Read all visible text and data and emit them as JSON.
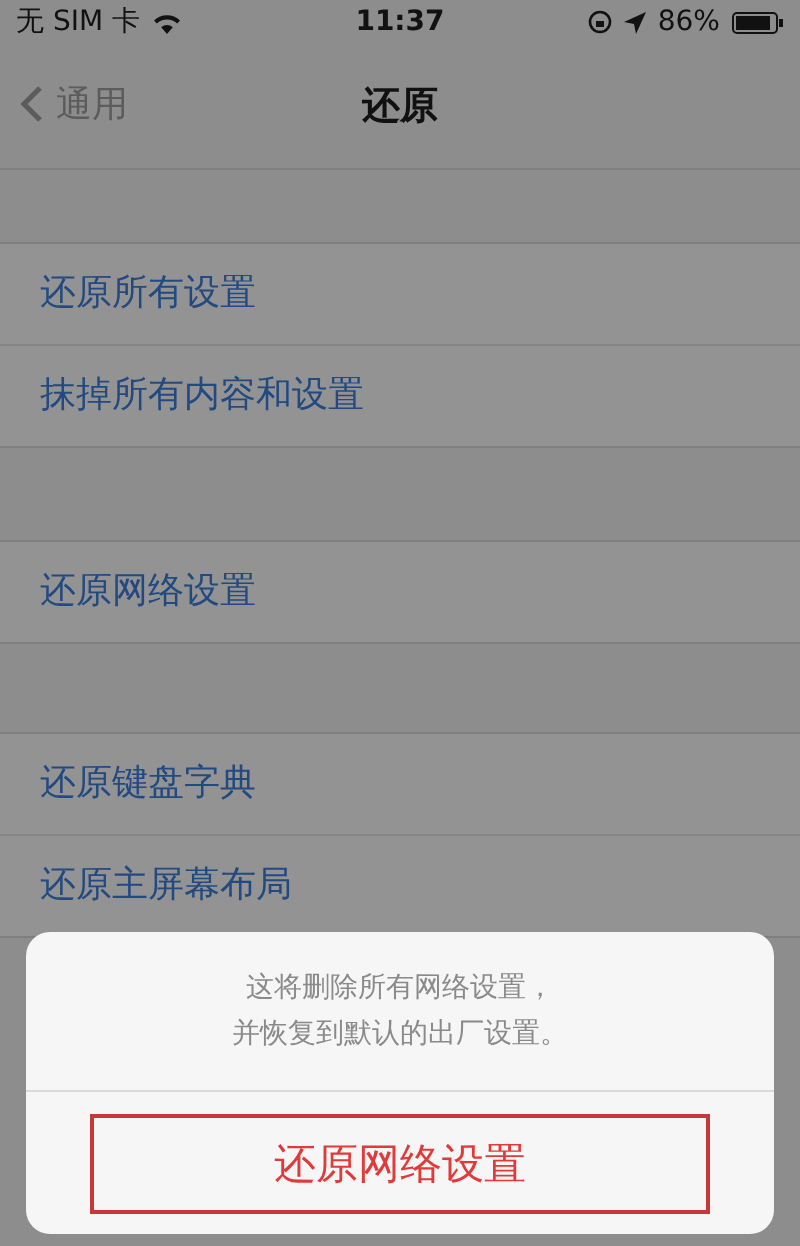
{
  "status_bar": {
    "carrier": "无 SIM 卡",
    "time": "11:37",
    "battery": "86%"
  },
  "nav": {
    "back": "通用",
    "title": "还原"
  },
  "groups": [
    {
      "items": [
        "还原所有设置",
        "抹掉所有内容和设置"
      ]
    },
    {
      "items": [
        "还原网络设置"
      ]
    },
    {
      "items": [
        "还原键盘字典",
        "还原主屏幕布局"
      ]
    }
  ],
  "sheet": {
    "message": [
      "这将删除所有网络设置，",
      "并恢复到默认的出厂设置。"
    ],
    "action": "还原网络设置"
  }
}
